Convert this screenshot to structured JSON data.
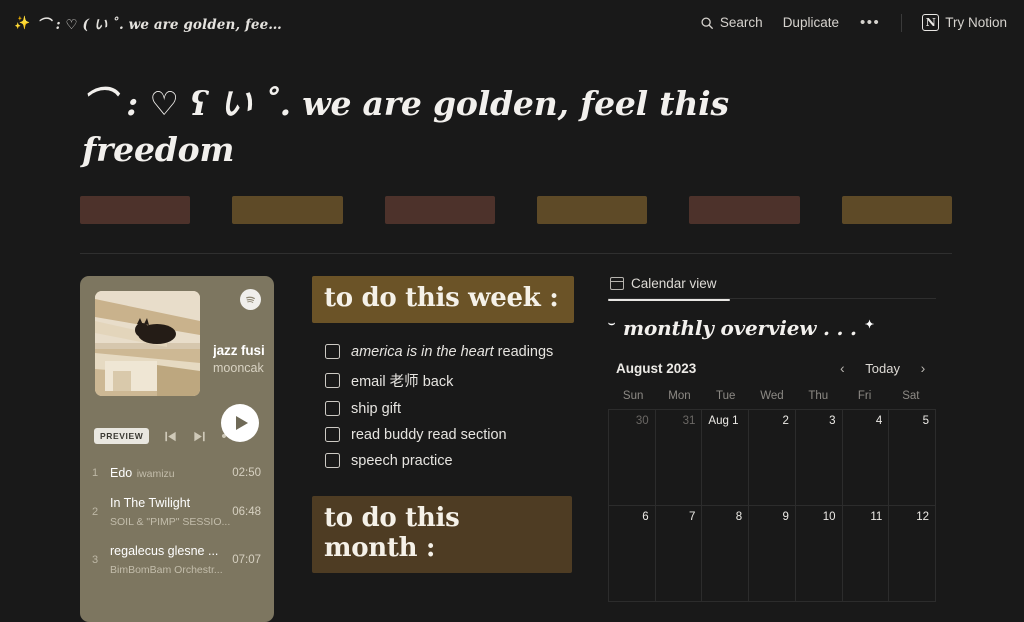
{
  "topbar": {
    "favicon": "✨",
    "breadcrumb": "⌒ : ♡ ( い ˚. we are golden, fee…",
    "search_label": "Search",
    "search_icon": "search-icon",
    "duplicate_label": "Duplicate",
    "more_label": "•••",
    "try_notion_label": "Try Notion",
    "notion_logo_glyph": "N"
  },
  "page": {
    "title": "⌒ : ♡ ʕ い ˚. we are golden, feel this freedom"
  },
  "bars": [
    {
      "color": "#4d322b"
    },
    {
      "color": "#5e4a27"
    },
    {
      "color": "#4d322b"
    },
    {
      "color": "#5e4a27"
    },
    {
      "color": "#4d322b"
    },
    {
      "color": "#5e4a27"
    }
  ],
  "spotify": {
    "track_title": "jazz fusi",
    "artist": "mooncak",
    "preview_label": "PREVIEW",
    "more_label": "•••",
    "tracks": [
      {
        "num": "1",
        "title": "Edo",
        "artist": "iwamizu",
        "duration": "02:50"
      },
      {
        "num": "2",
        "title": "In The Twilight",
        "artist": "SOIL & \"PIMP\" SESSIO...",
        "duration": "06:48"
      },
      {
        "num": "3",
        "title": "regalecus glesne ...",
        "artist": "BimBomBam Orchestr...",
        "duration": "07:07"
      }
    ]
  },
  "todo": {
    "week_heading": "to do this week :",
    "week_heading_bg": "#6b5327",
    "month_heading": "to do this month :",
    "month_heading_bg": "#4e3c23",
    "items": [
      {
        "emphasis": "america is in the heart",
        "rest": " readings"
      },
      {
        "emphasis": "",
        "rest": "email 老师 back"
      },
      {
        "emphasis": "",
        "rest": "ship gift"
      },
      {
        "emphasis": "",
        "rest": "read buddy read section"
      },
      {
        "emphasis": "",
        "rest": "speech practice"
      }
    ]
  },
  "calendar": {
    "tab_label": "Calendar view",
    "heading": "monthly overview . . .",
    "heading_spark_left": "⌣",
    "heading_spark_right": "✦",
    "month_label": "August 2023",
    "today_label": "Today",
    "prev_icon": "‹",
    "next_icon": "›",
    "weekdays": [
      "Sun",
      "Mon",
      "Tue",
      "Wed",
      "Thu",
      "Fri",
      "Sat"
    ],
    "rows": [
      [
        {
          "label": "30",
          "dim": true
        },
        {
          "label": "31",
          "dim": true
        },
        {
          "label": "Aug 1",
          "dim": false,
          "first": true
        },
        {
          "label": "2",
          "dim": false
        },
        {
          "label": "3",
          "dim": false
        },
        {
          "label": "4",
          "dim": false
        },
        {
          "label": "5",
          "dim": false
        }
      ],
      [
        {
          "label": "6",
          "dim": false
        },
        {
          "label": "7",
          "dim": false
        },
        {
          "label": "8",
          "dim": false
        },
        {
          "label": "9",
          "dim": false
        },
        {
          "label": "10",
          "dim": false
        },
        {
          "label": "11",
          "dim": false
        },
        {
          "label": "12",
          "dim": false
        }
      ]
    ]
  }
}
